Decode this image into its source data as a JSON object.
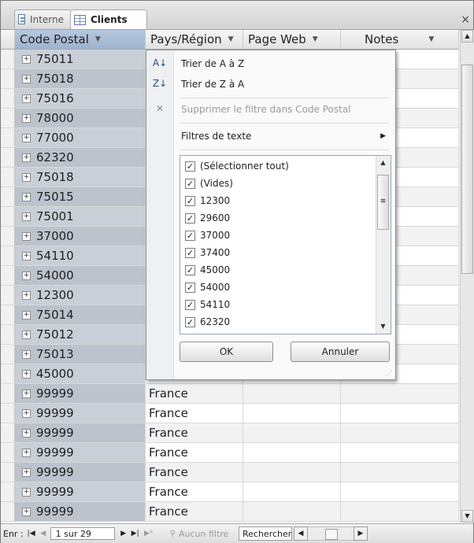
{
  "tabs": [
    {
      "label": "Interne",
      "icon": "form-icon",
      "active": false
    },
    {
      "label": "Clients",
      "icon": "table-icon",
      "active": true
    }
  ],
  "close_symbol": "×",
  "columns": [
    {
      "label": "Code Postal",
      "arrow": "▼"
    },
    {
      "label": "Pays/Région",
      "arrow": "▼"
    },
    {
      "label": "Page Web",
      "arrow": "▼"
    },
    {
      "label": "Notes",
      "arrow": "▼"
    }
  ],
  "rows": [
    {
      "cp": "75011",
      "pays": ""
    },
    {
      "cp": "75018",
      "pays": ""
    },
    {
      "cp": "75016",
      "pays": ""
    },
    {
      "cp": "78000",
      "pays": ""
    },
    {
      "cp": "77000",
      "pays": ""
    },
    {
      "cp": "62320",
      "pays": ""
    },
    {
      "cp": "75018",
      "pays": ""
    },
    {
      "cp": "75015",
      "pays": ""
    },
    {
      "cp": "75001",
      "pays": ""
    },
    {
      "cp": "37000",
      "pays": ""
    },
    {
      "cp": "54110",
      "pays": ""
    },
    {
      "cp": "54000",
      "pays": ""
    },
    {
      "cp": "12300",
      "pays": ""
    },
    {
      "cp": "75014",
      "pays": ""
    },
    {
      "cp": "75012",
      "pays": ""
    },
    {
      "cp": "75013",
      "pays": ""
    },
    {
      "cp": "45000",
      "pays": "France"
    },
    {
      "cp": "99999",
      "pays": "France"
    },
    {
      "cp": "99999",
      "pays": "France"
    },
    {
      "cp": "99999",
      "pays": "France"
    },
    {
      "cp": "99999",
      "pays": "France"
    },
    {
      "cp": "99999",
      "pays": "France"
    },
    {
      "cp": "99999",
      "pays": "France"
    },
    {
      "cp": "99999",
      "pays": "France"
    }
  ],
  "filter_menu": {
    "sort_asc": "Trier de A à Z",
    "sort_desc": "Trier de Z à A",
    "clear_filter": "Supprimer le filtre dans Code Postal",
    "text_filters": "Filtres de texte",
    "items": [
      {
        "label": "(Sélectionner tout)",
        "checked": true
      },
      {
        "label": "(Vides)",
        "checked": true
      },
      {
        "label": "12300",
        "checked": true
      },
      {
        "label": "29600",
        "checked": true
      },
      {
        "label": "37000",
        "checked": true
      },
      {
        "label": "37400",
        "checked": true
      },
      {
        "label": "45000",
        "checked": true
      },
      {
        "label": "54000",
        "checked": true
      },
      {
        "label": "54110",
        "checked": true
      },
      {
        "label": "62320",
        "checked": true
      }
    ],
    "ok_label": "OK",
    "cancel_label": "Annuler"
  },
  "status": {
    "record_label": "Enr :",
    "record_position": "1 sur 29",
    "filter_label": "Aucun filtre",
    "search_placeholder": "Rechercher"
  }
}
